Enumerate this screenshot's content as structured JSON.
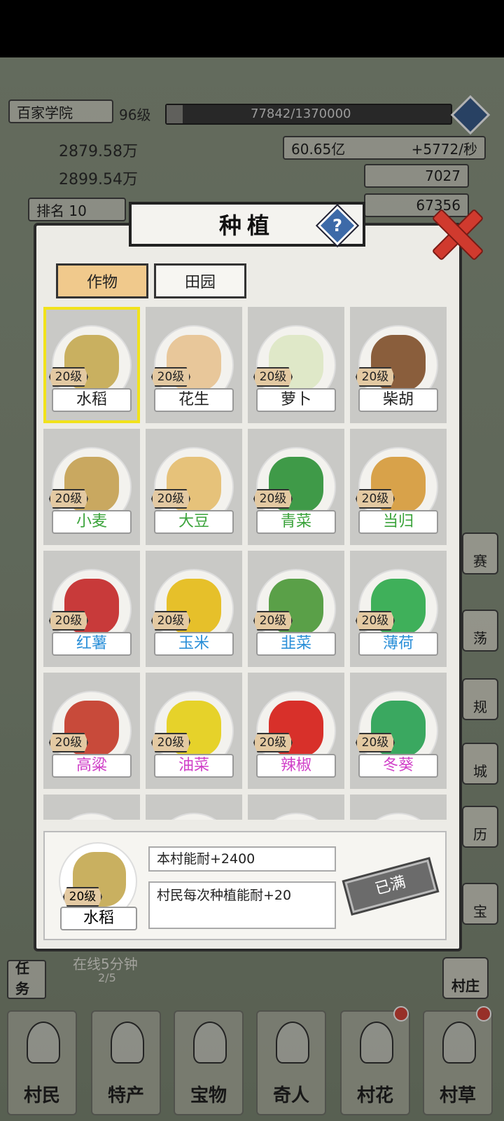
{
  "hud": {
    "academy": "百家学院",
    "level": "96级",
    "xp_text": "77842/1370000",
    "xp_fraction": 0.057,
    "stat1_value": "2879.58万",
    "stat2_value": "2899.54万",
    "rank": "排名 10",
    "coins": "60.65亿",
    "coins_rate": "+5772/秒",
    "gold": "7027",
    "other_value": "67356",
    "task_text": "在线5分钟",
    "task_progress": "2/5",
    "task_label": "任务",
    "village_label": "村庄",
    "side": [
      "赛",
      "荡",
      "规",
      "城",
      "历",
      "宝"
    ]
  },
  "nav": [
    "村民",
    "特产",
    "宝物",
    "奇人",
    "村花",
    "村草"
  ],
  "dialog": {
    "title": "种植",
    "tabs": [
      "作物",
      "田园"
    ],
    "crops": [
      {
        "name": "水稻",
        "level": "20级",
        "color": "#222222",
        "art": "#c9b060"
      },
      {
        "name": "花生",
        "level": "20级",
        "color": "#222222",
        "art": "#e8c79a"
      },
      {
        "name": "萝卜",
        "level": "20级",
        "color": "#222222",
        "art": "#dfe8c8"
      },
      {
        "name": "柴胡",
        "level": "20级",
        "color": "#222222",
        "art": "#8a5e3c"
      },
      {
        "name": "小麦",
        "level": "20级",
        "color": "#3aa33a",
        "art": "#c9a860"
      },
      {
        "name": "大豆",
        "level": "20级",
        "color": "#3aa33a",
        "art": "#e6c27a"
      },
      {
        "name": "青菜",
        "level": "20级",
        "color": "#3aa33a",
        "art": "#3f9a48"
      },
      {
        "name": "当归",
        "level": "20级",
        "color": "#3aa33a",
        "art": "#d8a24a"
      },
      {
        "name": "红薯",
        "level": "20级",
        "color": "#2a8fd8",
        "art": "#c83a3a"
      },
      {
        "name": "玉米",
        "level": "20级",
        "color": "#2a8fd8",
        "art": "#e6c02a"
      },
      {
        "name": "韭菜",
        "level": "20级",
        "color": "#2a8fd8",
        "art": "#5aa048"
      },
      {
        "name": "薄荷",
        "level": "20级",
        "color": "#2a8fd8",
        "art": "#3fb05a"
      },
      {
        "name": "高粱",
        "level": "20级",
        "color": "#d040c8",
        "art": "#c84a3a"
      },
      {
        "name": "油菜",
        "level": "20级",
        "color": "#d040c8",
        "art": "#e6d22a"
      },
      {
        "name": "辣椒",
        "level": "20级",
        "color": "#d040c8",
        "art": "#d8302a"
      },
      {
        "name": "冬葵",
        "level": "20级",
        "color": "#d040c8",
        "art": "#3aa860"
      }
    ],
    "selected": {
      "name": "水稻",
      "level": "20级",
      "bonus1": "本村能耐+2400",
      "bonus2": "村民每次种植能耐+20",
      "status": "已满"
    }
  }
}
